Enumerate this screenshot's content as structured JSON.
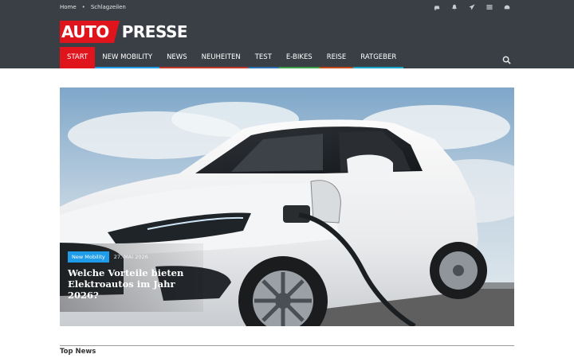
{
  "topbar": {
    "breadcrumb": [
      "Home",
      "Schlagzeilen"
    ],
    "icons": [
      "car-icon",
      "bell-icon",
      "paper-plane-icon",
      "list-icon",
      "dashboard-icon"
    ]
  },
  "brand": {
    "logo_part1": "AUTO",
    "logo_part2": "PRESSE",
    "accent": "#e0141c"
  },
  "nav": {
    "items": [
      {
        "label": "START",
        "color": "#e0141c"
      },
      {
        "label": "NEW MOBILITY",
        "color": "#1e9be9"
      },
      {
        "label": "NEWS",
        "color": "#c0392b"
      },
      {
        "label": "NEUHEITEN",
        "color": "#c0392b"
      },
      {
        "label": "TEST",
        "color": "#2a6fb0"
      },
      {
        "label": "E-BIKES",
        "color": "#3aa14a"
      },
      {
        "label": "REISE",
        "color": "#c24a1c"
      },
      {
        "label": "RATGEBER",
        "color": "#1aa7c9"
      }
    ],
    "search_icon": "search-icon"
  },
  "hero": {
    "category": "New Mobility",
    "date": "27. MAI 2026",
    "title": "Welche Vorteile bieten Elektroautos im Jahr 2026?"
  },
  "section": {
    "heading": "Top News"
  }
}
